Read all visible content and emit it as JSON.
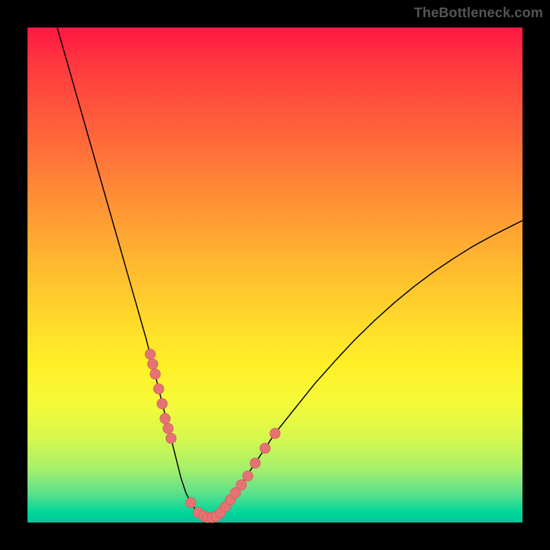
{
  "watermark": "TheBottleneck.com",
  "colors": {
    "curve": "#000000",
    "dot_fill": "#e57373",
    "dot_stroke": "#cc5b5b"
  },
  "chart_data": {
    "type": "line",
    "title": "",
    "xlabel": "",
    "ylabel": "",
    "xlim": [
      0,
      100
    ],
    "ylim": [
      0,
      100
    ],
    "grid": false,
    "legend": false,
    "series": [
      {
        "name": "bottleneck_curve",
        "x": [
          6,
          8,
          10,
          12,
          14,
          16,
          18,
          20,
          22,
          24,
          25,
          26,
          27,
          28,
          29,
          30,
          31,
          32,
          33,
          34,
          35,
          36,
          37,
          38,
          39,
          40,
          42,
          44,
          46,
          48,
          50,
          54,
          58,
          62,
          66,
          70,
          74,
          78,
          82,
          86,
          90,
          94,
          98,
          100
        ],
        "y": [
          100,
          93,
          86,
          79,
          72,
          65,
          58,
          51,
          44,
          37,
          33,
          29,
          25,
          21,
          17,
          13,
          9,
          6,
          4,
          2.5,
          1.5,
          1,
          1,
          1.2,
          2,
          3.2,
          6,
          9,
          12,
          15,
          18,
          23,
          28,
          32.5,
          36.8,
          40.7,
          44.3,
          47.6,
          50.6,
          53.3,
          55.8,
          58,
          60,
          61
        ]
      }
    ],
    "dots": {
      "name": "highlight_points",
      "x": [
        24.8,
        25.3,
        25.8,
        26.5,
        27.2,
        27.8,
        28.4,
        29.0,
        33.0,
        34.5,
        35.6,
        36.4,
        37.3,
        38.1,
        39.0,
        40.0,
        41.0,
        42.0,
        43.2,
        44.5,
        46.0,
        48.0,
        50.0
      ],
      "y": [
        34,
        32,
        30,
        27,
        24,
        21,
        19,
        17,
        4,
        2,
        1.3,
        1,
        1,
        1.2,
        2,
        3.2,
        4.6,
        6,
        7.6,
        9.4,
        12,
        15,
        18
      ]
    },
    "dot_radius": 7.5
  }
}
